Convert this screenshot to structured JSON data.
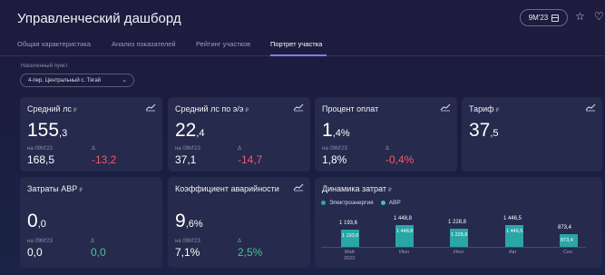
{
  "header": {
    "title": "Управленческий дашборд",
    "period": "9М'23"
  },
  "tabs": [
    {
      "label": "Общая характеристика"
    },
    {
      "label": "Анализ показателей"
    },
    {
      "label": "Рейтинг участков"
    },
    {
      "label": "Портрет участка",
      "active": true
    }
  ],
  "filter": {
    "label": "Населенный пункт",
    "value": "4-пер. Центральный с. Тягай"
  },
  "cards": {
    "avg_ls": {
      "title": "Средний лс",
      "ruble": "₽",
      "value_int": "155",
      "value_dec": ",3",
      "cmp_label": "на 09М'23",
      "cmp_value": "168,5",
      "delta_label": "Δ",
      "delta_value": "-13,2"
    },
    "avg_ls_ee": {
      "title": "Средний лс по э/э",
      "ruble": "₽",
      "value_int": "22",
      "value_dec": ",4",
      "cmp_label": "на 09М'23",
      "cmp_value": "37,1",
      "delta_label": "Δ",
      "delta_value": "-14,7"
    },
    "pay_pct": {
      "title": "Процент оплат",
      "value_int": "1",
      "value_dec": ",4",
      "value_unit": "%",
      "cmp_label": "на 09М'23",
      "cmp_value": "1,8%",
      "delta_label": "Δ",
      "delta_value": "-0,4%"
    },
    "tariff": {
      "title": "Тариф",
      "ruble": "₽",
      "value_int": "37",
      "value_dec": ",5"
    },
    "avr_cost": {
      "title": "Затраты АВР",
      "ruble": "₽",
      "value_int": "0",
      "value_dec": ",0",
      "cmp_label": "на 09М'23",
      "cmp_value": "0,0",
      "delta_label": "Δ",
      "delta_value": "0,0"
    },
    "accident": {
      "title": "Коэффициент аварийности",
      "value_int": "9",
      "value_dec": ",6",
      "value_unit": "%",
      "cmp_label": "на 09М'23",
      "cmp_value": "7,1%",
      "delta_label": "Δ",
      "delta_value": "2,5%"
    }
  },
  "cost_chart": {
    "title": "Динамика затрат",
    "ruble": "₽",
    "legend": [
      {
        "name": "Электроэнергия",
        "color": "#2aa6a6"
      },
      {
        "name": "АВР",
        "color": "#45c49a"
      }
    ]
  },
  "chart_data": {
    "type": "bar",
    "title": "Динамика затрат",
    "categories": [
      "Май",
      "Июн",
      "Июл",
      "Авг",
      "Сен"
    ],
    "category_sub": [
      "2023",
      "",
      "",
      "",
      ""
    ],
    "series": [
      {
        "name": "Электроэнергия",
        "values": [
          1193.6,
          1448.8,
          1228.8,
          1446.5,
          873.4
        ]
      },
      {
        "name": "АВР",
        "values": [
          0,
          0,
          0,
          0,
          0
        ]
      }
    ],
    "total_labels": [
      "1 193,6",
      "1 448,8",
      "1 228,8",
      "1 446,5",
      "873,4"
    ],
    "bar_labels": [
      "1 193,6",
      "1 448,8",
      "1 228,8",
      "1 446,5",
      "873,4"
    ],
    "ylim": [
      0,
      1600
    ]
  }
}
